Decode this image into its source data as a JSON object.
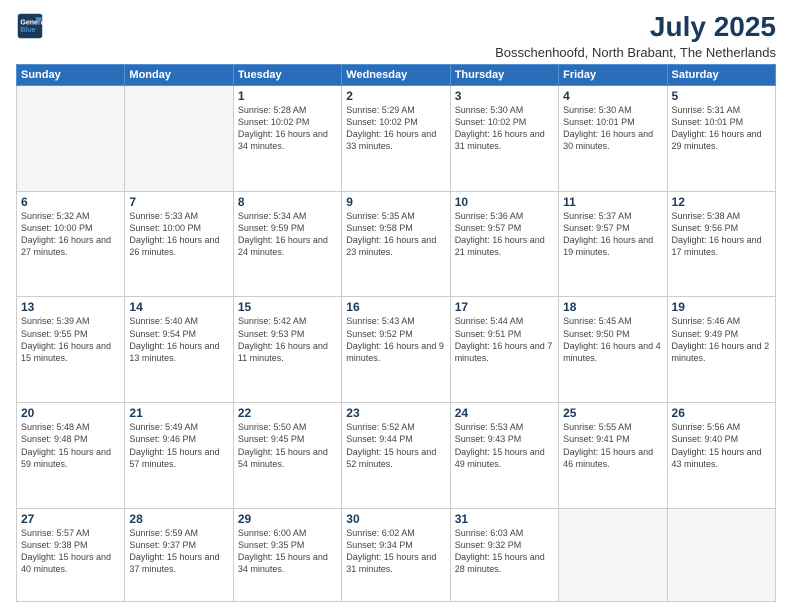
{
  "logo": {
    "line1": "General",
    "line2": "Blue"
  },
  "title": "July 2025",
  "subtitle": "Bosschenhoofd, North Brabant, The Netherlands",
  "weekdays": [
    "Sunday",
    "Monday",
    "Tuesday",
    "Wednesday",
    "Thursday",
    "Friday",
    "Saturday"
  ],
  "weeks": [
    [
      {
        "day": null
      },
      {
        "day": null
      },
      {
        "day": "1",
        "info": "Sunrise: 5:28 AM\nSunset: 10:02 PM\nDaylight: 16 hours\nand 34 minutes."
      },
      {
        "day": "2",
        "info": "Sunrise: 5:29 AM\nSunset: 10:02 PM\nDaylight: 16 hours\nand 33 minutes."
      },
      {
        "day": "3",
        "info": "Sunrise: 5:30 AM\nSunset: 10:02 PM\nDaylight: 16 hours\nand 31 minutes."
      },
      {
        "day": "4",
        "info": "Sunrise: 5:30 AM\nSunset: 10:01 PM\nDaylight: 16 hours\nand 30 minutes."
      },
      {
        "day": "5",
        "info": "Sunrise: 5:31 AM\nSunset: 10:01 PM\nDaylight: 16 hours\nand 29 minutes."
      }
    ],
    [
      {
        "day": "6",
        "info": "Sunrise: 5:32 AM\nSunset: 10:00 PM\nDaylight: 16 hours\nand 27 minutes."
      },
      {
        "day": "7",
        "info": "Sunrise: 5:33 AM\nSunset: 10:00 PM\nDaylight: 16 hours\nand 26 minutes."
      },
      {
        "day": "8",
        "info": "Sunrise: 5:34 AM\nSunset: 9:59 PM\nDaylight: 16 hours\nand 24 minutes."
      },
      {
        "day": "9",
        "info": "Sunrise: 5:35 AM\nSunset: 9:58 PM\nDaylight: 16 hours\nand 23 minutes."
      },
      {
        "day": "10",
        "info": "Sunrise: 5:36 AM\nSunset: 9:57 PM\nDaylight: 16 hours\nand 21 minutes."
      },
      {
        "day": "11",
        "info": "Sunrise: 5:37 AM\nSunset: 9:57 PM\nDaylight: 16 hours\nand 19 minutes."
      },
      {
        "day": "12",
        "info": "Sunrise: 5:38 AM\nSunset: 9:56 PM\nDaylight: 16 hours\nand 17 minutes."
      }
    ],
    [
      {
        "day": "13",
        "info": "Sunrise: 5:39 AM\nSunset: 9:55 PM\nDaylight: 16 hours\nand 15 minutes."
      },
      {
        "day": "14",
        "info": "Sunrise: 5:40 AM\nSunset: 9:54 PM\nDaylight: 16 hours\nand 13 minutes."
      },
      {
        "day": "15",
        "info": "Sunrise: 5:42 AM\nSunset: 9:53 PM\nDaylight: 16 hours\nand 11 minutes."
      },
      {
        "day": "16",
        "info": "Sunrise: 5:43 AM\nSunset: 9:52 PM\nDaylight: 16 hours\nand 9 minutes."
      },
      {
        "day": "17",
        "info": "Sunrise: 5:44 AM\nSunset: 9:51 PM\nDaylight: 16 hours\nand 7 minutes."
      },
      {
        "day": "18",
        "info": "Sunrise: 5:45 AM\nSunset: 9:50 PM\nDaylight: 16 hours\nand 4 minutes."
      },
      {
        "day": "19",
        "info": "Sunrise: 5:46 AM\nSunset: 9:49 PM\nDaylight: 16 hours\nand 2 minutes."
      }
    ],
    [
      {
        "day": "20",
        "info": "Sunrise: 5:48 AM\nSunset: 9:48 PM\nDaylight: 15 hours\nand 59 minutes."
      },
      {
        "day": "21",
        "info": "Sunrise: 5:49 AM\nSunset: 9:46 PM\nDaylight: 15 hours\nand 57 minutes."
      },
      {
        "day": "22",
        "info": "Sunrise: 5:50 AM\nSunset: 9:45 PM\nDaylight: 15 hours\nand 54 minutes."
      },
      {
        "day": "23",
        "info": "Sunrise: 5:52 AM\nSunset: 9:44 PM\nDaylight: 15 hours\nand 52 minutes."
      },
      {
        "day": "24",
        "info": "Sunrise: 5:53 AM\nSunset: 9:43 PM\nDaylight: 15 hours\nand 49 minutes."
      },
      {
        "day": "25",
        "info": "Sunrise: 5:55 AM\nSunset: 9:41 PM\nDaylight: 15 hours\nand 46 minutes."
      },
      {
        "day": "26",
        "info": "Sunrise: 5:56 AM\nSunset: 9:40 PM\nDaylight: 15 hours\nand 43 minutes."
      }
    ],
    [
      {
        "day": "27",
        "info": "Sunrise: 5:57 AM\nSunset: 9:38 PM\nDaylight: 15 hours\nand 40 minutes."
      },
      {
        "day": "28",
        "info": "Sunrise: 5:59 AM\nSunset: 9:37 PM\nDaylight: 15 hours\nand 37 minutes."
      },
      {
        "day": "29",
        "info": "Sunrise: 6:00 AM\nSunset: 9:35 PM\nDaylight: 15 hours\nand 34 minutes."
      },
      {
        "day": "30",
        "info": "Sunrise: 6:02 AM\nSunset: 9:34 PM\nDaylight: 15 hours\nand 31 minutes."
      },
      {
        "day": "31",
        "info": "Sunrise: 6:03 AM\nSunset: 9:32 PM\nDaylight: 15 hours\nand 28 minutes."
      },
      {
        "day": null
      },
      {
        "day": null
      }
    ]
  ]
}
